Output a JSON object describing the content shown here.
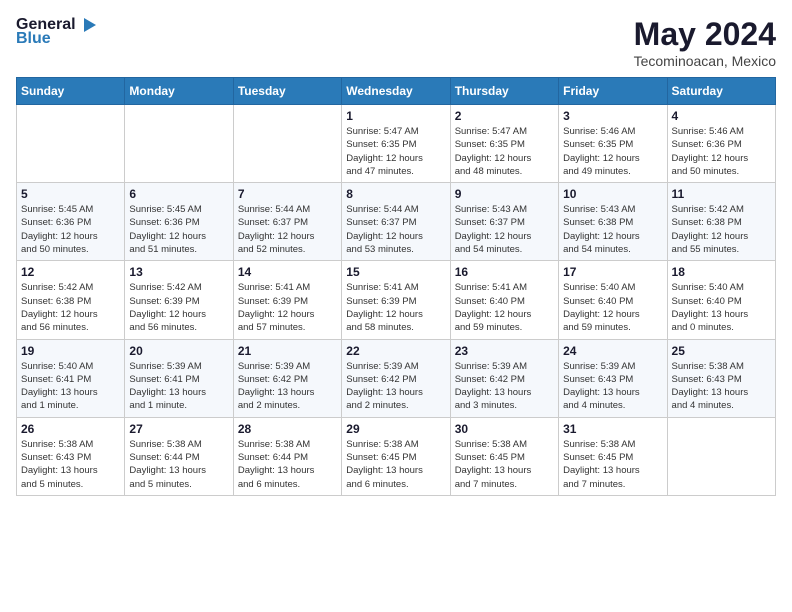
{
  "header": {
    "logo_line1": "General",
    "logo_line2": "Blue",
    "month": "May 2024",
    "location": "Tecominoacan, Mexico"
  },
  "weekdays": [
    "Sunday",
    "Monday",
    "Tuesday",
    "Wednesday",
    "Thursday",
    "Friday",
    "Saturday"
  ],
  "weeks": [
    [
      {
        "day": "",
        "info": ""
      },
      {
        "day": "",
        "info": ""
      },
      {
        "day": "",
        "info": ""
      },
      {
        "day": "1",
        "info": "Sunrise: 5:47 AM\nSunset: 6:35 PM\nDaylight: 12 hours\nand 47 minutes."
      },
      {
        "day": "2",
        "info": "Sunrise: 5:47 AM\nSunset: 6:35 PM\nDaylight: 12 hours\nand 48 minutes."
      },
      {
        "day": "3",
        "info": "Sunrise: 5:46 AM\nSunset: 6:35 PM\nDaylight: 12 hours\nand 49 minutes."
      },
      {
        "day": "4",
        "info": "Sunrise: 5:46 AM\nSunset: 6:36 PM\nDaylight: 12 hours\nand 50 minutes."
      }
    ],
    [
      {
        "day": "5",
        "info": "Sunrise: 5:45 AM\nSunset: 6:36 PM\nDaylight: 12 hours\nand 50 minutes."
      },
      {
        "day": "6",
        "info": "Sunrise: 5:45 AM\nSunset: 6:36 PM\nDaylight: 12 hours\nand 51 minutes."
      },
      {
        "day": "7",
        "info": "Sunrise: 5:44 AM\nSunset: 6:37 PM\nDaylight: 12 hours\nand 52 minutes."
      },
      {
        "day": "8",
        "info": "Sunrise: 5:44 AM\nSunset: 6:37 PM\nDaylight: 12 hours\nand 53 minutes."
      },
      {
        "day": "9",
        "info": "Sunrise: 5:43 AM\nSunset: 6:37 PM\nDaylight: 12 hours\nand 54 minutes."
      },
      {
        "day": "10",
        "info": "Sunrise: 5:43 AM\nSunset: 6:38 PM\nDaylight: 12 hours\nand 54 minutes."
      },
      {
        "day": "11",
        "info": "Sunrise: 5:42 AM\nSunset: 6:38 PM\nDaylight: 12 hours\nand 55 minutes."
      }
    ],
    [
      {
        "day": "12",
        "info": "Sunrise: 5:42 AM\nSunset: 6:38 PM\nDaylight: 12 hours\nand 56 minutes."
      },
      {
        "day": "13",
        "info": "Sunrise: 5:42 AM\nSunset: 6:39 PM\nDaylight: 12 hours\nand 56 minutes."
      },
      {
        "day": "14",
        "info": "Sunrise: 5:41 AM\nSunset: 6:39 PM\nDaylight: 12 hours\nand 57 minutes."
      },
      {
        "day": "15",
        "info": "Sunrise: 5:41 AM\nSunset: 6:39 PM\nDaylight: 12 hours\nand 58 minutes."
      },
      {
        "day": "16",
        "info": "Sunrise: 5:41 AM\nSunset: 6:40 PM\nDaylight: 12 hours\nand 59 minutes."
      },
      {
        "day": "17",
        "info": "Sunrise: 5:40 AM\nSunset: 6:40 PM\nDaylight: 12 hours\nand 59 minutes."
      },
      {
        "day": "18",
        "info": "Sunrise: 5:40 AM\nSunset: 6:40 PM\nDaylight: 13 hours\nand 0 minutes."
      }
    ],
    [
      {
        "day": "19",
        "info": "Sunrise: 5:40 AM\nSunset: 6:41 PM\nDaylight: 13 hours\nand 1 minute."
      },
      {
        "day": "20",
        "info": "Sunrise: 5:39 AM\nSunset: 6:41 PM\nDaylight: 13 hours\nand 1 minute."
      },
      {
        "day": "21",
        "info": "Sunrise: 5:39 AM\nSunset: 6:42 PM\nDaylight: 13 hours\nand 2 minutes."
      },
      {
        "day": "22",
        "info": "Sunrise: 5:39 AM\nSunset: 6:42 PM\nDaylight: 13 hours\nand 2 minutes."
      },
      {
        "day": "23",
        "info": "Sunrise: 5:39 AM\nSunset: 6:42 PM\nDaylight: 13 hours\nand 3 minutes."
      },
      {
        "day": "24",
        "info": "Sunrise: 5:39 AM\nSunset: 6:43 PM\nDaylight: 13 hours\nand 4 minutes."
      },
      {
        "day": "25",
        "info": "Sunrise: 5:38 AM\nSunset: 6:43 PM\nDaylight: 13 hours\nand 4 minutes."
      }
    ],
    [
      {
        "day": "26",
        "info": "Sunrise: 5:38 AM\nSunset: 6:43 PM\nDaylight: 13 hours\nand 5 minutes."
      },
      {
        "day": "27",
        "info": "Sunrise: 5:38 AM\nSunset: 6:44 PM\nDaylight: 13 hours\nand 5 minutes."
      },
      {
        "day": "28",
        "info": "Sunrise: 5:38 AM\nSunset: 6:44 PM\nDaylight: 13 hours\nand 6 minutes."
      },
      {
        "day": "29",
        "info": "Sunrise: 5:38 AM\nSunset: 6:45 PM\nDaylight: 13 hours\nand 6 minutes."
      },
      {
        "day": "30",
        "info": "Sunrise: 5:38 AM\nSunset: 6:45 PM\nDaylight: 13 hours\nand 7 minutes."
      },
      {
        "day": "31",
        "info": "Sunrise: 5:38 AM\nSunset: 6:45 PM\nDaylight: 13 hours\nand 7 minutes."
      },
      {
        "day": "",
        "info": ""
      }
    ]
  ]
}
